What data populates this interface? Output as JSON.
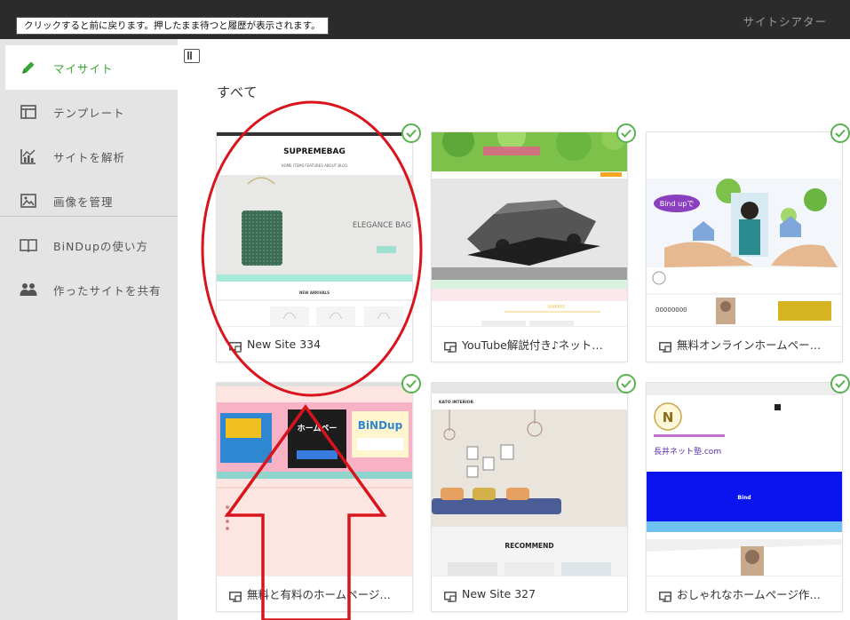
{
  "window": {
    "title": "サイトシアター",
    "tooltip": "クリックすると前に戻ります。押したまま待つと履歴が表示されます。"
  },
  "sidebar": {
    "items": [
      {
        "label": "マイサイト",
        "icon": "pencil-icon"
      },
      {
        "label": "テンプレート",
        "icon": "template-icon"
      },
      {
        "label": "サイトを解析",
        "icon": "chart-icon"
      },
      {
        "label": "画像を管理",
        "icon": "image-icon"
      },
      {
        "label": "BiNDupの使い方",
        "icon": "book-icon"
      },
      {
        "label": "作ったサイトを共有",
        "icon": "users-icon"
      }
    ]
  },
  "main": {
    "section_title": "すべて",
    "sites": [
      {
        "name": "New Site 334"
      },
      {
        "name": "YouTube解説付き♪ネット…"
      },
      {
        "name": "無料オンラインホームペー…"
      },
      {
        "name": "無料と有料のホームページ…"
      },
      {
        "name": "New Site 327"
      },
      {
        "name": "おしゃれなホームページ作…"
      }
    ]
  },
  "thumbs": {
    "t1": {
      "brand": "SUPREMEBAG",
      "nav": "HOME ITEMS FEATURES ABOUT BLOG",
      "hero": "ELEGANCE BAG",
      "section": "NEW ARRIVALS"
    },
    "t2": {
      "label": "000000"
    },
    "t3": {
      "bubble": "Bind upで",
      "label": "00000000"
    },
    "t4": {
      "logo": "BiNDup"
    },
    "t5": {
      "brand": "KATO INTERIOR",
      "section": "RECOMMEND"
    },
    "t6": {
      "logo": "N",
      "title": "長井ネット塾.com",
      "band": "Bind"
    }
  },
  "colors": {
    "accent": "#3aa635",
    "topbar": "#2b2b2b",
    "sidebar": "#e4e4e4",
    "check": "#59b152",
    "annotation": "#d9141c"
  }
}
